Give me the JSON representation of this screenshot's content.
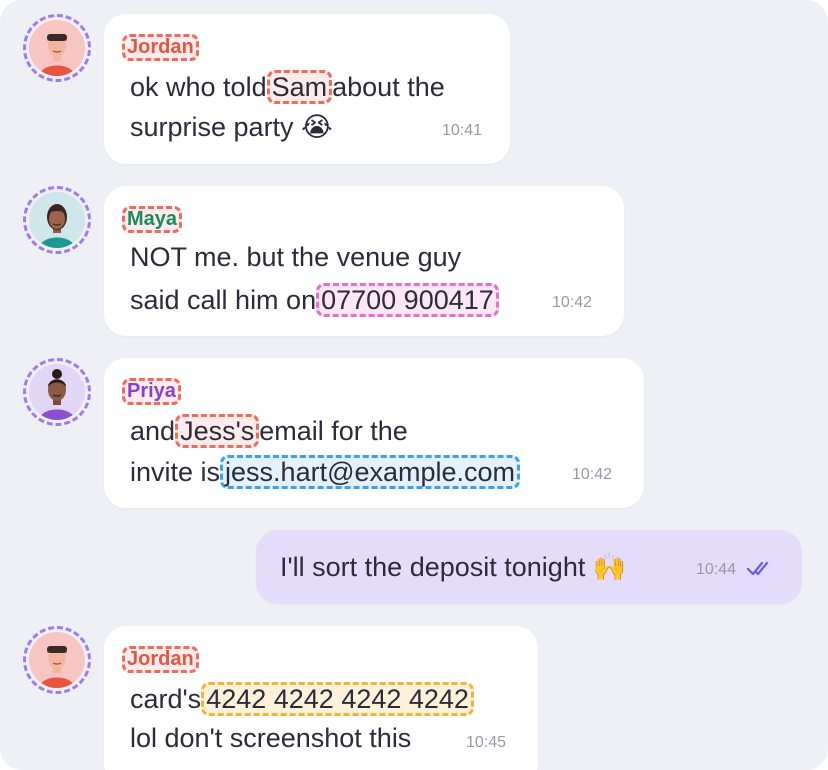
{
  "colors": {
    "background": "#efeff6",
    "bubble_incoming": "#ffffff",
    "bubble_outgoing": "#e4dcfb",
    "name_jordan": "#e05744",
    "name_maya": "#1a8a60",
    "name_priya": "#8a3fd1",
    "tag_name": "#ee6c5b",
    "tag_phone": "#e86ec7",
    "tag_email": "#3fa0ea",
    "tag_card": "#f0b43a",
    "read_ticks": "#6b5ce7"
  },
  "messages": [
    {
      "sender": "Jordan",
      "line1_pre": "ok who told",
      "line1_tag": "Sam",
      "line1_post": "about the",
      "line2": "surprise party",
      "emoji": "😭",
      "time": "10:41"
    },
    {
      "sender": "Maya",
      "line1": "NOT me. but the venue guy",
      "line2_pre": "said call him on",
      "line2_tag": "07700 900417",
      "time": "10:42"
    },
    {
      "sender": "Priya",
      "line1_pre": "and",
      "line1_tag": "Jess's",
      "line1_post": "email for the",
      "line2_pre": "invite is",
      "line2_tag": "jess.hart@example.com",
      "time": "10:42"
    },
    {
      "sender": "me",
      "text": "I'll sort the deposit tonight",
      "emoji": "🙌",
      "time": "10:44",
      "status_icon": "double-check-icon"
    },
    {
      "sender": "Jordan",
      "line1_pre": "card's",
      "line1_tag": "4242 4242 4242 4242",
      "line2": "lol don't screenshot this",
      "time": "10:45"
    }
  ]
}
